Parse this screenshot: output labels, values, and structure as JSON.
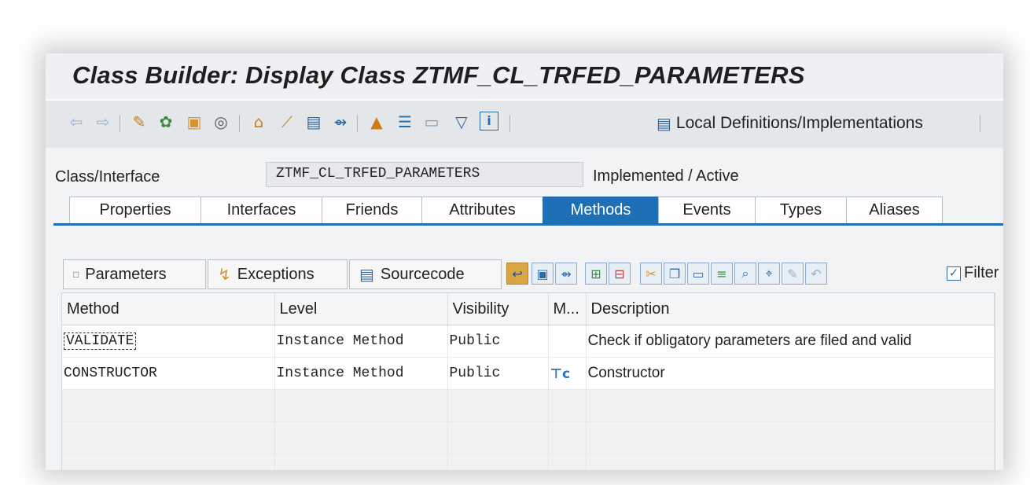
{
  "window": {
    "title": "Class Builder: Display Class ZTMF_CL_TRFED_PARAMETERS"
  },
  "toolbar": {
    "icons": [
      "back-arrow-icon",
      "forward-arrow-icon",
      "other-object-icon",
      "display-change-icon",
      "activate-icon",
      "check-icon",
      "where-used-icon",
      "magic-wand-icon",
      "object-list-icon",
      "navigate-icon",
      "hierarchy-icon",
      "pretty-print-icon",
      "layout-icon",
      "filter-icon",
      "info-icon"
    ],
    "local_definitions_label": "Local Definitions/Implementations"
  },
  "header": {
    "field_label": "Class/Interface",
    "field_value": "ZTMF_CL_TRFED_PARAMETERS",
    "status": "Implemented / Active"
  },
  "tabs": [
    {
      "label": "Properties"
    },
    {
      "label": "Interfaces"
    },
    {
      "label": "Friends"
    },
    {
      "label": "Attributes"
    },
    {
      "label": "Methods",
      "active": true
    },
    {
      "label": "Events"
    },
    {
      "label": "Types"
    },
    {
      "label": "Aliases"
    }
  ],
  "subbar": {
    "parameters_label": "Parameters",
    "exceptions_label": "Exceptions",
    "sourcecode_label": "Sourcecode",
    "filter_label": "Filter",
    "filter_checked": true
  },
  "grid": {
    "columns": [
      "Method",
      "Level",
      "Visibility",
      "M...",
      "Description"
    ],
    "rows": [
      {
        "method": "VALIDATE",
        "level": "Instance Method",
        "visibility": "Public",
        "modeled": "",
        "description": "Check if obligatory parameters are filed and valid"
      },
      {
        "method": "CONSTRUCTOR",
        "level": "Instance Method",
        "visibility": "Public",
        "modeled": "constructor-icon",
        "description": "Constructor"
      }
    ]
  },
  "colors": {
    "accent": "#1f6fb5",
    "background": "#eef0f3"
  }
}
